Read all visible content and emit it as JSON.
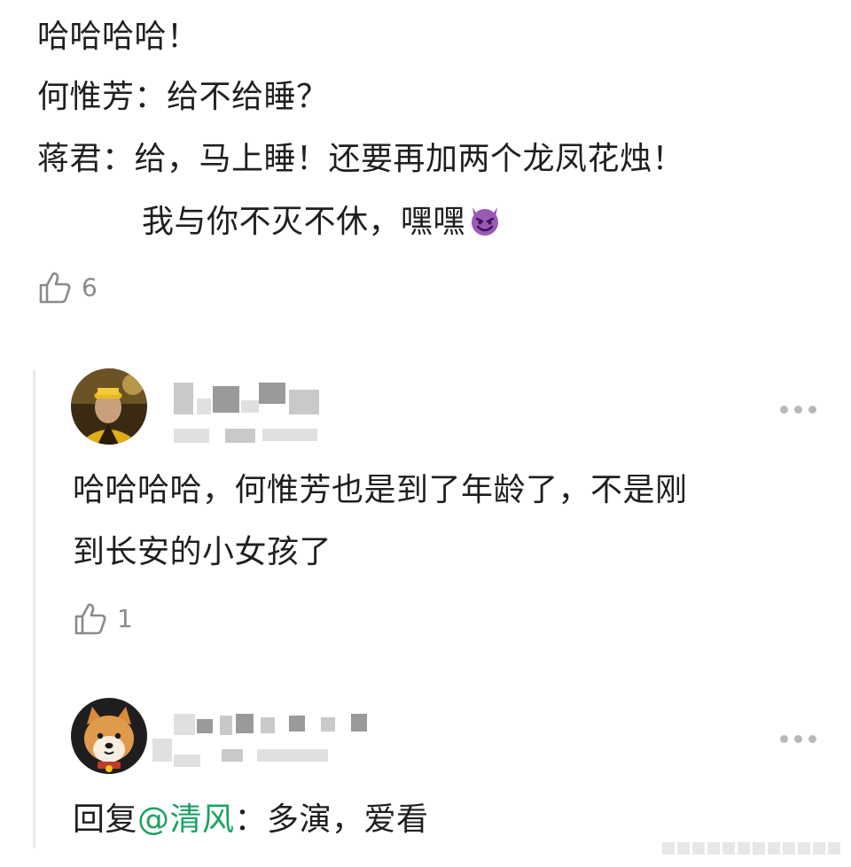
{
  "top_comment": {
    "lines": [
      "哈哈哈哈！",
      "何惟芳：给不给睡？",
      "蒋君：给，马上睡！还要再加两个龙凤花烛！",
      "我与你不灭不休，嘿嘿"
    ],
    "emoji": "smiling-devil-emoji",
    "likes": "6"
  },
  "replies": [
    {
      "avatar": "man-in-yellow-hat-avatar",
      "text_lines": [
        "哈哈哈哈，何惟芳也是到了年龄了，不是刚",
        "到长安的小女孩了"
      ],
      "likes": "1"
    },
    {
      "avatar": "shiba-dog-avatar",
      "reply_prefix": "回复",
      "mention": "@清风",
      "reply_text": "：多演，爱看"
    }
  ],
  "colors": {
    "mention": "#1aa260",
    "text": "#1f1f1f",
    "muted": "#8a8a8a"
  }
}
